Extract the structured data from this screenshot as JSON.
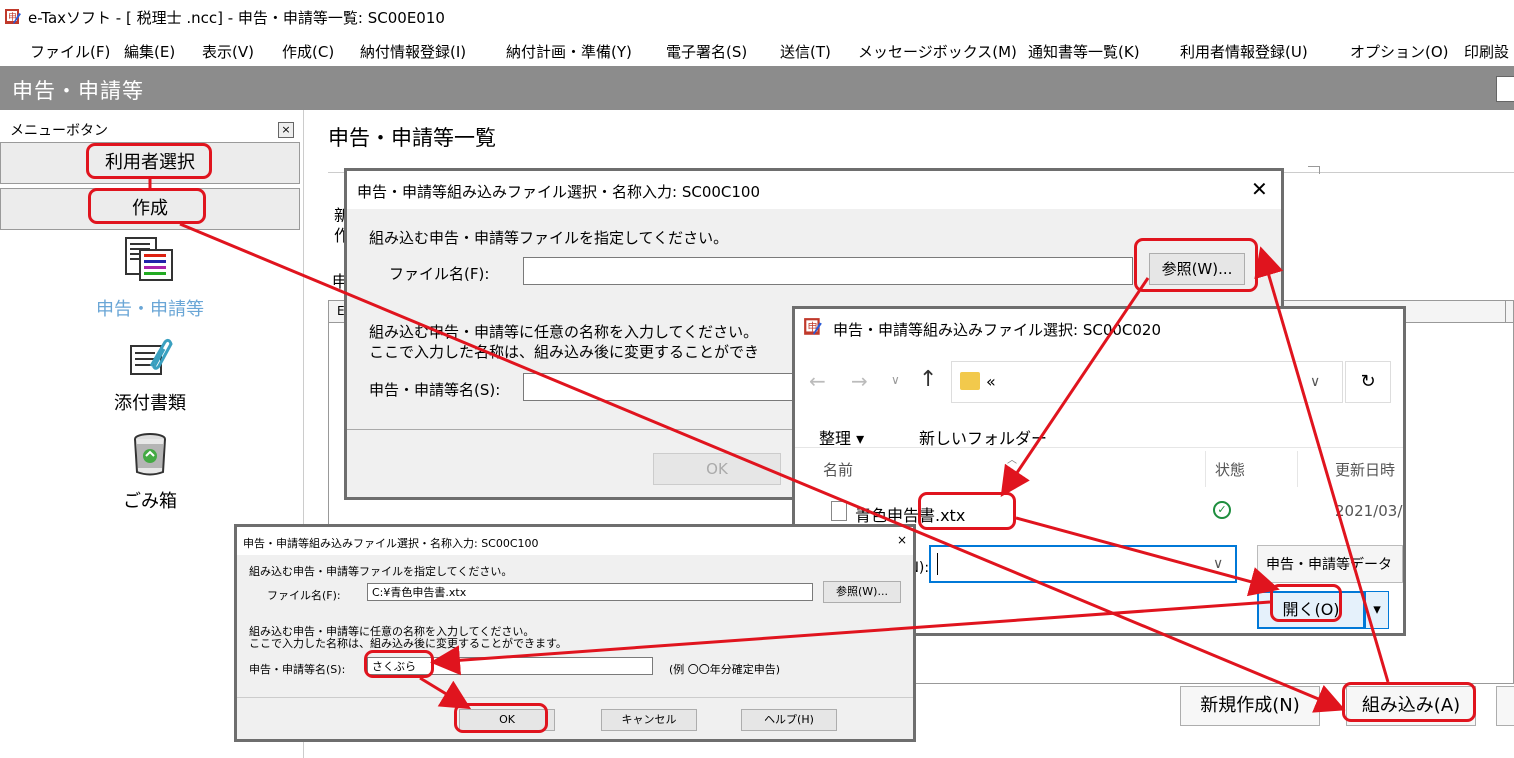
{
  "window": {
    "title": "e-Taxソフト - [ 税理士 .ncc] - 申告・申請等一覧: SC00E010"
  },
  "menubar": {
    "items": [
      {
        "label": "ファイル(F)",
        "name": "menu-file"
      },
      {
        "label": "編集(E)",
        "name": "menu-edit"
      },
      {
        "label": "表示(V)",
        "name": "menu-view"
      },
      {
        "label": "作成(C)",
        "name": "menu-create"
      },
      {
        "label": "納付情報登録(I)",
        "name": "menu-payment-info"
      },
      {
        "label": "納付計画・準備(Y)",
        "name": "menu-payment-plan"
      },
      {
        "label": "電子署名(S)",
        "name": "menu-signature"
      },
      {
        "label": "送信(T)",
        "name": "menu-send"
      },
      {
        "label": "メッセージボックス(M)",
        "name": "menu-messagebox"
      },
      {
        "label": "通知書等一覧(K)",
        "name": "menu-notices"
      },
      {
        "label": "利用者情報登録(U)",
        "name": "menu-user-info"
      },
      {
        "label": "オプション(O)",
        "name": "menu-options"
      },
      {
        "label": "印刷設",
        "name": "menu-print"
      }
    ]
  },
  "section_header": "申告・申請等",
  "sidebar": {
    "label": "メニューボタン",
    "close": "×",
    "user_select": "利用者選択",
    "create": "作成",
    "tools": {
      "declaration": "申告・申請等",
      "attachments": "添付書類",
      "trash": "ごみ箱"
    }
  },
  "main": {
    "heading": "申告・申請等一覧",
    "partial_text_1": "新",
    "partial_text_2": "作",
    "partial_text_3": "申",
    "partial_text_4": "E",
    "new_button": "新規作成(N)",
    "import_button": "組み込み(A)"
  },
  "dialog1": {
    "title": "申告・申請等組み込みファイル選択・名称入力: SC00C100",
    "close": "✕",
    "instruction1": "組み込む申告・申請等ファイルを指定してください。",
    "file_label": "ファイル名(F):",
    "browse_button": "参照(W)...",
    "instruction2_line1": "組み込む申告・申請等に任意の名称を入力してください。",
    "instruction2_line2": "ここで入力した名称は、組み込み後に変更することができ",
    "name_label": "申告・申請等名(S):",
    "ok_button": "OK"
  },
  "dialog2": {
    "title": "申告・申請等組み込みファイル選択: SC00C020",
    "path": "«",
    "organize": "整理 ▾",
    "new_folder": "新しいフォルダー",
    "col_name": "名前",
    "col_status": "状態",
    "col_modified": "更新日時",
    "file_name": "青色申告書.xtx",
    "file_date": "2021/03/",
    "filename_label": "ル名(N):",
    "filter": "申告・申請等データ",
    "open_button": "開く(O)",
    "dropdown": "▾"
  },
  "dialog3": {
    "title": "申告・申請等組み込みファイル選択・名称入力: SC00C100",
    "close": "×",
    "instruction1": "組み込む申告・申請等ファイルを指定してください。",
    "file_label": "ファイル名(F):",
    "file_value": "C:¥青色申告書.xtx",
    "browse_button": "参照(W)...",
    "instruction2_line1": "組み込む申告・申請等に任意の名称を入力してください。",
    "instruction2_line2": "ここで入力した名称は、組み込み後に変更することができます。",
    "name_label": "申告・申請等名(S):",
    "name_value": "さくぶら",
    "example": "(例 〇〇年分確定申告)",
    "ok_button": "OK",
    "cancel_button": "キャンセル",
    "help_button": "ヘルプ(H)"
  },
  "colors": {
    "annotation_red": "#e0141e",
    "header_gray": "#8c8c8c",
    "focus_blue": "#0078d7",
    "accent_blue": "#6aa6d6"
  }
}
